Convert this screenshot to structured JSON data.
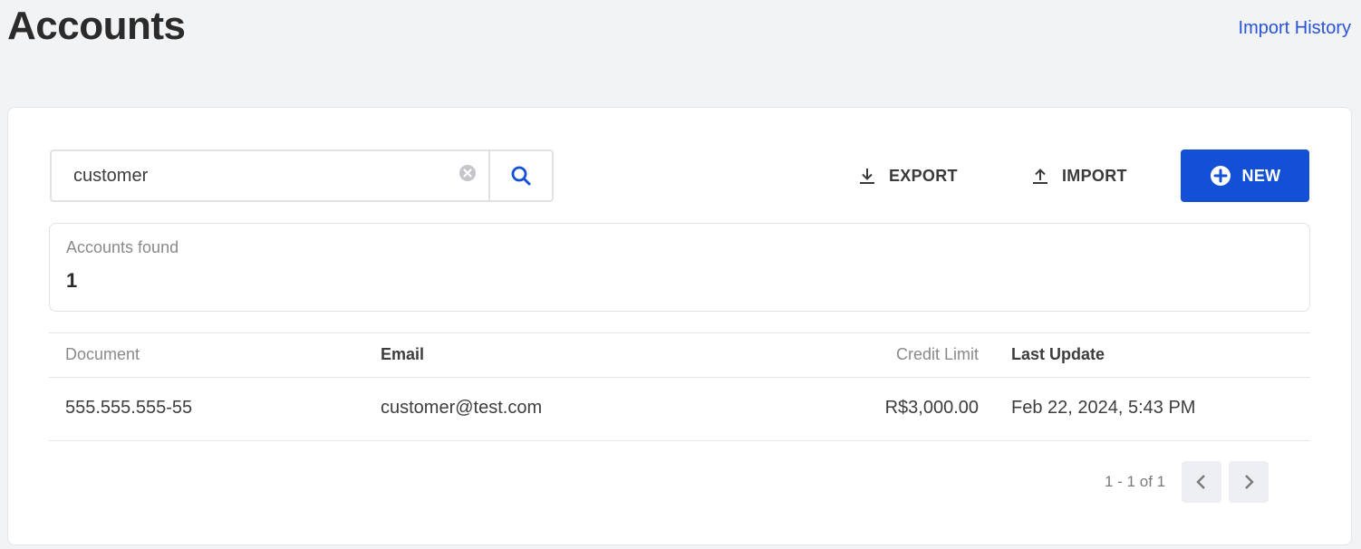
{
  "header": {
    "title": "Accounts",
    "import_history_label": "Import History"
  },
  "toolbar": {
    "search_value": "customer",
    "export_label": "EXPORT",
    "import_label": "IMPORT",
    "new_label": "NEW"
  },
  "summary": {
    "label": "Accounts found",
    "value": "1"
  },
  "table": {
    "columns": [
      "Document",
      "Email",
      "Credit Limit",
      "Last Update"
    ],
    "rows": [
      {
        "document": "555.555.555-55",
        "email": "customer@test.com",
        "credit_limit": "R$3,000.00",
        "last_update": "Feb 22, 2024, 5:43 PM"
      }
    ]
  },
  "pagination": {
    "info": "1 - 1 of 1"
  },
  "icons": {
    "clear": "clear-icon",
    "search": "search-icon",
    "export": "download-icon",
    "import": "upload-icon",
    "new": "plus-circle-icon",
    "prev": "chevron-left-icon",
    "next": "chevron-right-icon"
  },
  "colors": {
    "accent": "#1450d6",
    "link": "#2953d6",
    "background": "#f2f3f5"
  }
}
